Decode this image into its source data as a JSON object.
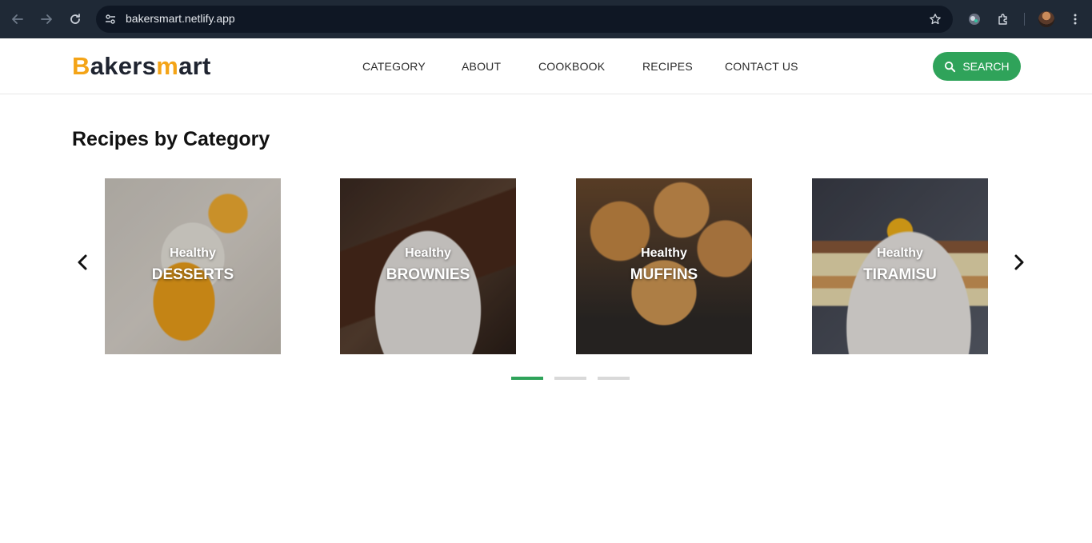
{
  "browser": {
    "url": "bakersmart.netlify.app"
  },
  "site": {
    "logo": {
      "part1_accent": "B",
      "part2": "akers",
      "part3_accent": "m",
      "part4": "art",
      "accent_color": "#f4a417"
    },
    "nav": [
      {
        "label": "CATEGORY"
      },
      {
        "label": "ABOUT"
      },
      {
        "label": "COOKBOOK"
      },
      {
        "label": "RECIPES"
      },
      {
        "label": "CONTACT US"
      }
    ],
    "search_label": "SEARCH",
    "brand_color": "#2fa35a"
  },
  "section": {
    "title": "Recipes by Category",
    "cards": [
      {
        "kicker": "Healthy",
        "name": "DESSERTS"
      },
      {
        "kicker": "Healthy",
        "name": "BROWNIES"
      },
      {
        "kicker": "Healthy",
        "name": "MUFFINS"
      },
      {
        "kicker": "Healthy",
        "name": "TIRAMISU"
      }
    ],
    "pagination": {
      "pages": 3,
      "active": 1
    }
  }
}
